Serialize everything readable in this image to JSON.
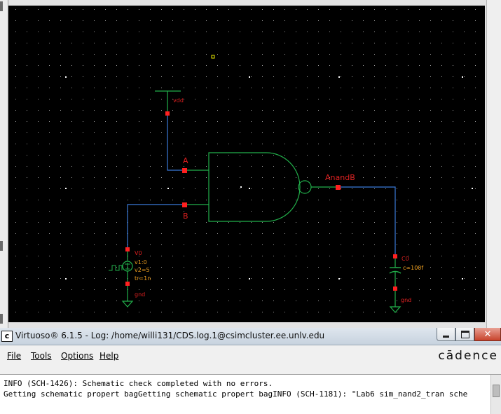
{
  "schematic": {
    "labels": {
      "vdd": "vdd",
      "input_a": "A",
      "input_b": "B",
      "output": "AnandB",
      "source_name": "V0",
      "source_v1": "v1:0",
      "source_v2": "v2=5",
      "source_tr": "tr=1n",
      "source_gnd": "gnd",
      "cap_name": "C0",
      "cap_value": "c=100f",
      "cap_gnd": "gnd"
    },
    "colors": {
      "background": "#000000",
      "grid_dot": "#9a9a9a",
      "wire": "#3b7ad9",
      "symbol": "#22b04b",
      "pin": "#ff2020",
      "label": "#e02020",
      "param_label": "#f0a020",
      "selection": "#e8e800"
    }
  },
  "log_window": {
    "title": "Virtuoso® 6.1.5 - Log: /home/willi131/CDS.log.1@csimcluster.ee.unlv.edu",
    "app_icon": "c",
    "menu": [
      "File",
      "Tools",
      "Options",
      "Help"
    ],
    "brand": "cādence",
    "lines": [
      "INFO (SCH-1426): Schematic check completed with no errors.",
      "Getting schematic propert bagGetting schematic propert bagINFO (SCH-1181): \"Lab6 sim_nand2_tran sche"
    ]
  }
}
